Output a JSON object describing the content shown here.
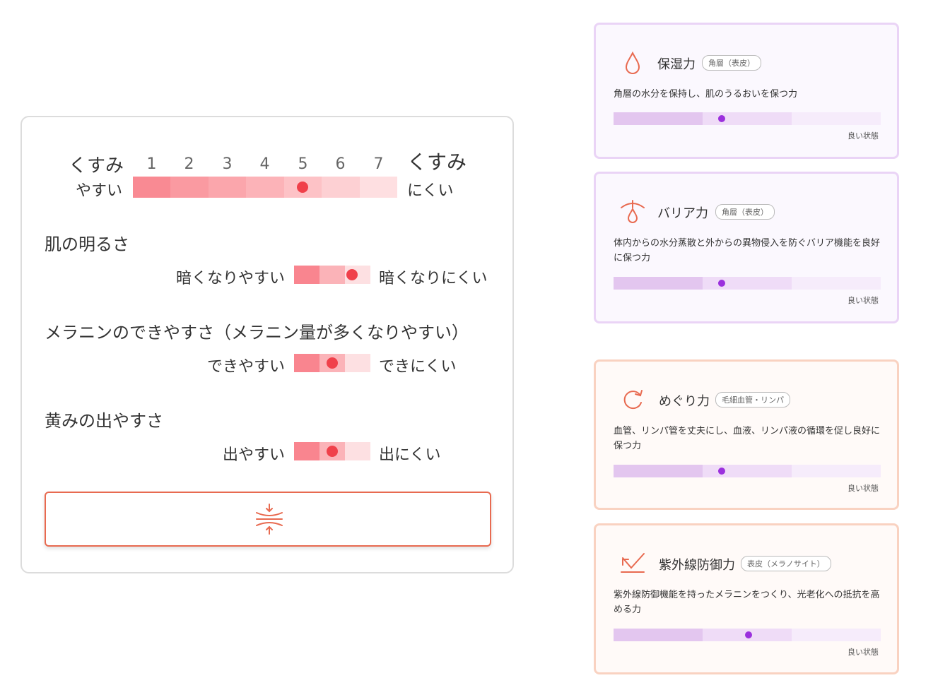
{
  "kusumi_scale": {
    "left_top": "くすみ",
    "left_bottom": "やすい",
    "right_top": "くすみ",
    "right_bottom": "にくい",
    "numbers": [
      "1",
      "2",
      "3",
      "4",
      "5",
      "6",
      "7"
    ],
    "selected": 5
  },
  "traits": [
    {
      "title": "肌の明るさ",
      "low": "暗くなりやすい",
      "high": "暗くなりにくい",
      "level": 3
    },
    {
      "title": "メラニンのできやすさ（メラニン量が多くなりやすい）",
      "low": "できやすい",
      "high": "できにくい",
      "level": 2
    },
    {
      "title": "黄みの出やすさ",
      "low": "出やすい",
      "high": "出にくい",
      "level": 2
    }
  ],
  "action_button_icon": "compress-vertical-icon",
  "cards": [
    {
      "icon": "droplet-icon",
      "title": "保湿力",
      "tag": "角層（表皮）",
      "desc": "角層の水分を保持し、肌のうるおいを保つ力",
      "level": 2,
      "good": "良い状態"
    },
    {
      "icon": "barrier-drop-icon",
      "title": "バリア力",
      "tag": "角層（表皮）",
      "desc": "体内からの水分蒸散と外からの異物侵入を防ぐバリア機能を良好に保つ力",
      "level": 2,
      "good": "良い状態"
    },
    {
      "icon": "circulation-icon",
      "title": "めぐり力",
      "tag": "毛細血管・リンパ",
      "desc": "血管、リンパ管を丈夫にし、血液、リンパ液の循環を促し良好に保つ力",
      "level": 2,
      "good": "良い状態"
    },
    {
      "icon": "uv-defense-icon",
      "title": "紫外線防御力",
      "tag": "表皮（メラノサイト）",
      "desc": "紫外線防御機能を持ったメラニンをつくり、光老化への抵抗を高める力",
      "level": 2,
      "good": "良い状態"
    }
  ],
  "colors": {
    "scale": [
      "#f98a93",
      "#fa9aa1",
      "#fba6ac",
      "#fcb3b8",
      "#fdc2c6",
      "#fdd0d3",
      "#fedfe1"
    ],
    "dot_red": "#f0404a",
    "bar_purple": [
      "#e3c6ef",
      "#efdcf7",
      "#f6ecfb"
    ],
    "dot_purple": "#9b30dd",
    "accent_orange": "#e86a50"
  }
}
